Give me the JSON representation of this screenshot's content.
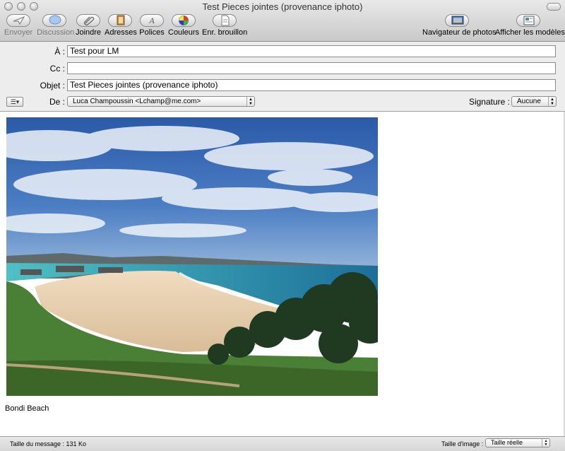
{
  "window": {
    "title": "Test Pieces jointes (provenance iphoto)"
  },
  "toolbar": {
    "send": "Envoyer",
    "chat": "Discussion",
    "attach": "Joindre",
    "addresses": "Adresses",
    "fonts": "Polices",
    "colors": "Couleurs",
    "save_draft": "Enr. brouillon",
    "photo_browser": "Navigateur de photos",
    "show_templates": "Afficher les modèles"
  },
  "header": {
    "to_label": "À :",
    "to_value": "Test pour LM",
    "cc_label": "Cc :",
    "cc_value": "",
    "subject_label": "Objet :",
    "subject_value": "Test Pieces jointes (provenance iphoto)",
    "from_label": "De :",
    "from_value": "Luca Champoussin <Lchamp@me.com>",
    "signature_label": "Signature :",
    "signature_value": "Aucune"
  },
  "body": {
    "caption": "Bondi Beach"
  },
  "status": {
    "message_size": "Taille du message : 131 Ko",
    "image_size_label": "Taille d'image :",
    "image_size_value": "Taille réelle"
  },
  "colors": {
    "sky": "#3f6fb8",
    "sea": "#1e8fa6",
    "sand": "#e8d3b5",
    "grass": "#4f8a3a"
  }
}
